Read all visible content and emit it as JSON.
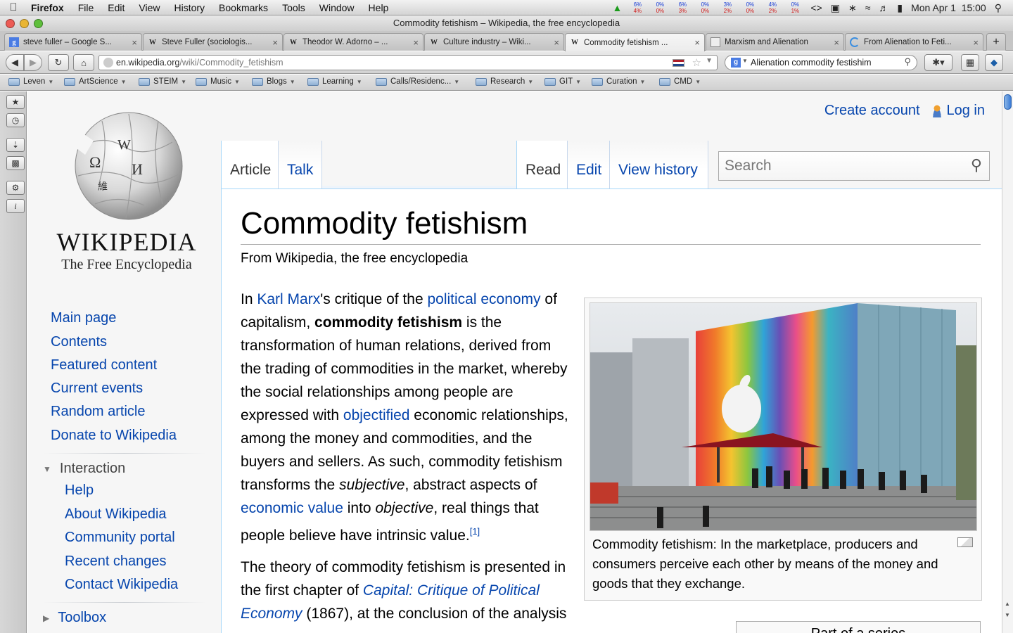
{
  "menubar": {
    "app": "Firefox",
    "items": [
      "File",
      "Edit",
      "View",
      "History",
      "Bookmarks",
      "Tools",
      "Window",
      "Help"
    ],
    "cpu": [
      [
        "6%",
        "4%"
      ],
      [
        "0%",
        "0%"
      ],
      [
        "6%",
        "3%"
      ],
      [
        "0%",
        "0%"
      ],
      [
        "3%",
        "2%"
      ],
      [
        "0%",
        "0%"
      ],
      [
        "4%",
        "2%"
      ],
      [
        "0%",
        "1%"
      ]
    ],
    "clock": "Mon Apr 1  15:00"
  },
  "window_title": "Commodity fetishism – Wikipedia, the free encyclopedia",
  "tabs": [
    {
      "title": "steve fuller – Google S...",
      "icon": "google-icon"
    },
    {
      "title": "Steve Fuller (sociologis...",
      "icon": "wikipedia-icon"
    },
    {
      "title": "Theodor W. Adorno – ...",
      "icon": "wikipedia-icon"
    },
    {
      "title": "Culture industry – Wiki...",
      "icon": "wikipedia-icon"
    },
    {
      "title": "Commodity fetishism ...",
      "icon": "wikipedia-icon",
      "active": true
    },
    {
      "title": "Marxism and Alienation",
      "icon": "page-icon"
    },
    {
      "title": "From Alienation to Feti...",
      "icon": "loading-icon"
    }
  ],
  "nav": {
    "url_host": "en.wikipedia.org",
    "url_path": "/wiki/Commodity_fetishism",
    "search_value": "Alienation commodity festishim"
  },
  "bookmarks": [
    "Leven",
    "ArtScience",
    "STEIM",
    "Music",
    "Blogs",
    "Learning",
    "Calls/Residenc...",
    "Research",
    "GIT",
    "Curation",
    "CMD"
  ],
  "wiki": {
    "logo_word": "WIKIPEDIA",
    "logo_tagline": "The Free Encyclopedia",
    "personal": {
      "create_account": "Create account",
      "log_in": "Log in"
    },
    "tabs_left": [
      "Article",
      "Talk"
    ],
    "tabs_right": [
      "Read",
      "Edit",
      "View history"
    ],
    "search_placeholder": "Search",
    "navigation": [
      "Main page",
      "Contents",
      "Featured content",
      "Current events",
      "Random article",
      "Donate to Wikipedia"
    ],
    "interaction": {
      "heading": "Interaction",
      "items": [
        "Help",
        "About Wikipedia",
        "Community portal",
        "Recent changes",
        "Contact Wikipedia"
      ]
    },
    "toolbox": "Toolbox",
    "title": "Commodity fetishism",
    "tagline": "From Wikipedia, the free encyclopedia",
    "lead": {
      "t1": "In ",
      "l1": "Karl Marx",
      "t2": "'s critique of the ",
      "l2": "political economy",
      "t3": " of capitalism, ",
      "b1": "commodity fetishism",
      "t4": " is the transformation of human relations, derived from the trading of commodities in the market, whereby the social relationships among people are expressed with ",
      "l3": "objectified",
      "t5": " economic relationships, among the money and commodities, and the buyers and sellers. As such, commodity fetishism transforms the ",
      "i1": "subjective",
      "t6": ", abstract aspects of ",
      "l4": "economic value",
      "t7": " into ",
      "i2": "objective",
      "t8": ", real things that people believe have intrinsic value.",
      "ref": "[1]"
    },
    "para2": {
      "t1": "The theory of commodity fetishism is presented in the first chapter of ",
      "l1": "Capital: Critique of Political Economy",
      "t2": " (1867), at the conclusion of the analysis"
    },
    "caption": "Commodity fetishism: In the marketplace, producers and consumers perceive each other by means of the money and goods that they exchange.",
    "toc_partial": "Part of a series"
  },
  "colors": {
    "link": "#0645ad",
    "sidebar_bg": "#f6f6f6",
    "content_border": "#a7d7f9"
  }
}
